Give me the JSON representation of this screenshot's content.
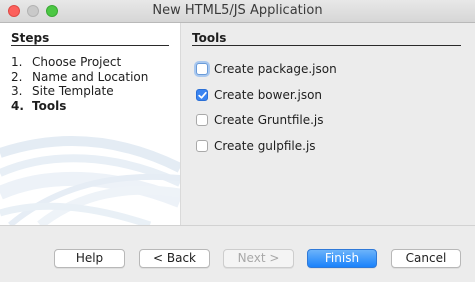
{
  "window": {
    "title": "New HTML5/JS Application"
  },
  "steps": {
    "title": "Steps",
    "items": [
      {
        "num": "1.",
        "label": "Choose Project"
      },
      {
        "num": "2.",
        "label": "Name and Location"
      },
      {
        "num": "3.",
        "label": "Site Template"
      },
      {
        "num": "4.",
        "label": "Tools"
      }
    ],
    "current_index": 3
  },
  "tools": {
    "title": "Tools",
    "options": [
      {
        "label": "Create package.json",
        "checked": false
      },
      {
        "label": "Create bower.json",
        "checked": true
      },
      {
        "label": "Create Gruntfile.js",
        "checked": false
      },
      {
        "label": "Create gulpfile.js",
        "checked": false
      }
    ]
  },
  "buttons": {
    "help": "Help",
    "back": "< Back",
    "next": "Next >",
    "finish": "Finish",
    "cancel": "Cancel"
  },
  "colors": {
    "accent": "#3a84f1",
    "primary_button": "#1a82fb",
    "close": "#fc605c",
    "maximize": "#4cc744"
  }
}
